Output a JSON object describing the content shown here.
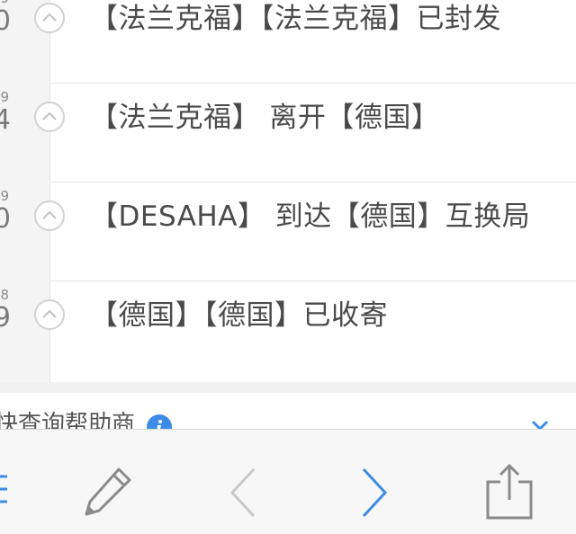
{
  "timeline": {
    "items": [
      {
        "time_small": "9",
        "time_big": "0",
        "text": "【法兰克福】【法兰克福】已封发"
      },
      {
        "time_small": "9",
        "time_big": "4",
        "text": "【法兰克福】 离开【德国】"
      },
      {
        "time_small": "9",
        "time_big": "0",
        "text": "【DESAHA】 到达【德国】互换局"
      },
      {
        "time_small": "8",
        "time_big": "9",
        "text": "【德国】【德国】已收寄"
      }
    ]
  },
  "banner": {
    "text": "快查询帮助商",
    "info_icon": "info-icon",
    "close_icon": "close-icon"
  },
  "toolbar": {
    "icons": [
      "menu-icon",
      "pencil-icon",
      "back-chevron-icon",
      "forward-chevron-icon",
      "share-icon"
    ]
  },
  "colors": {
    "accent": "#3c8ce7",
    "text": "#4a4a4a",
    "disabled": "#c8c8c8",
    "icon_gray": "#8a8a8a"
  }
}
